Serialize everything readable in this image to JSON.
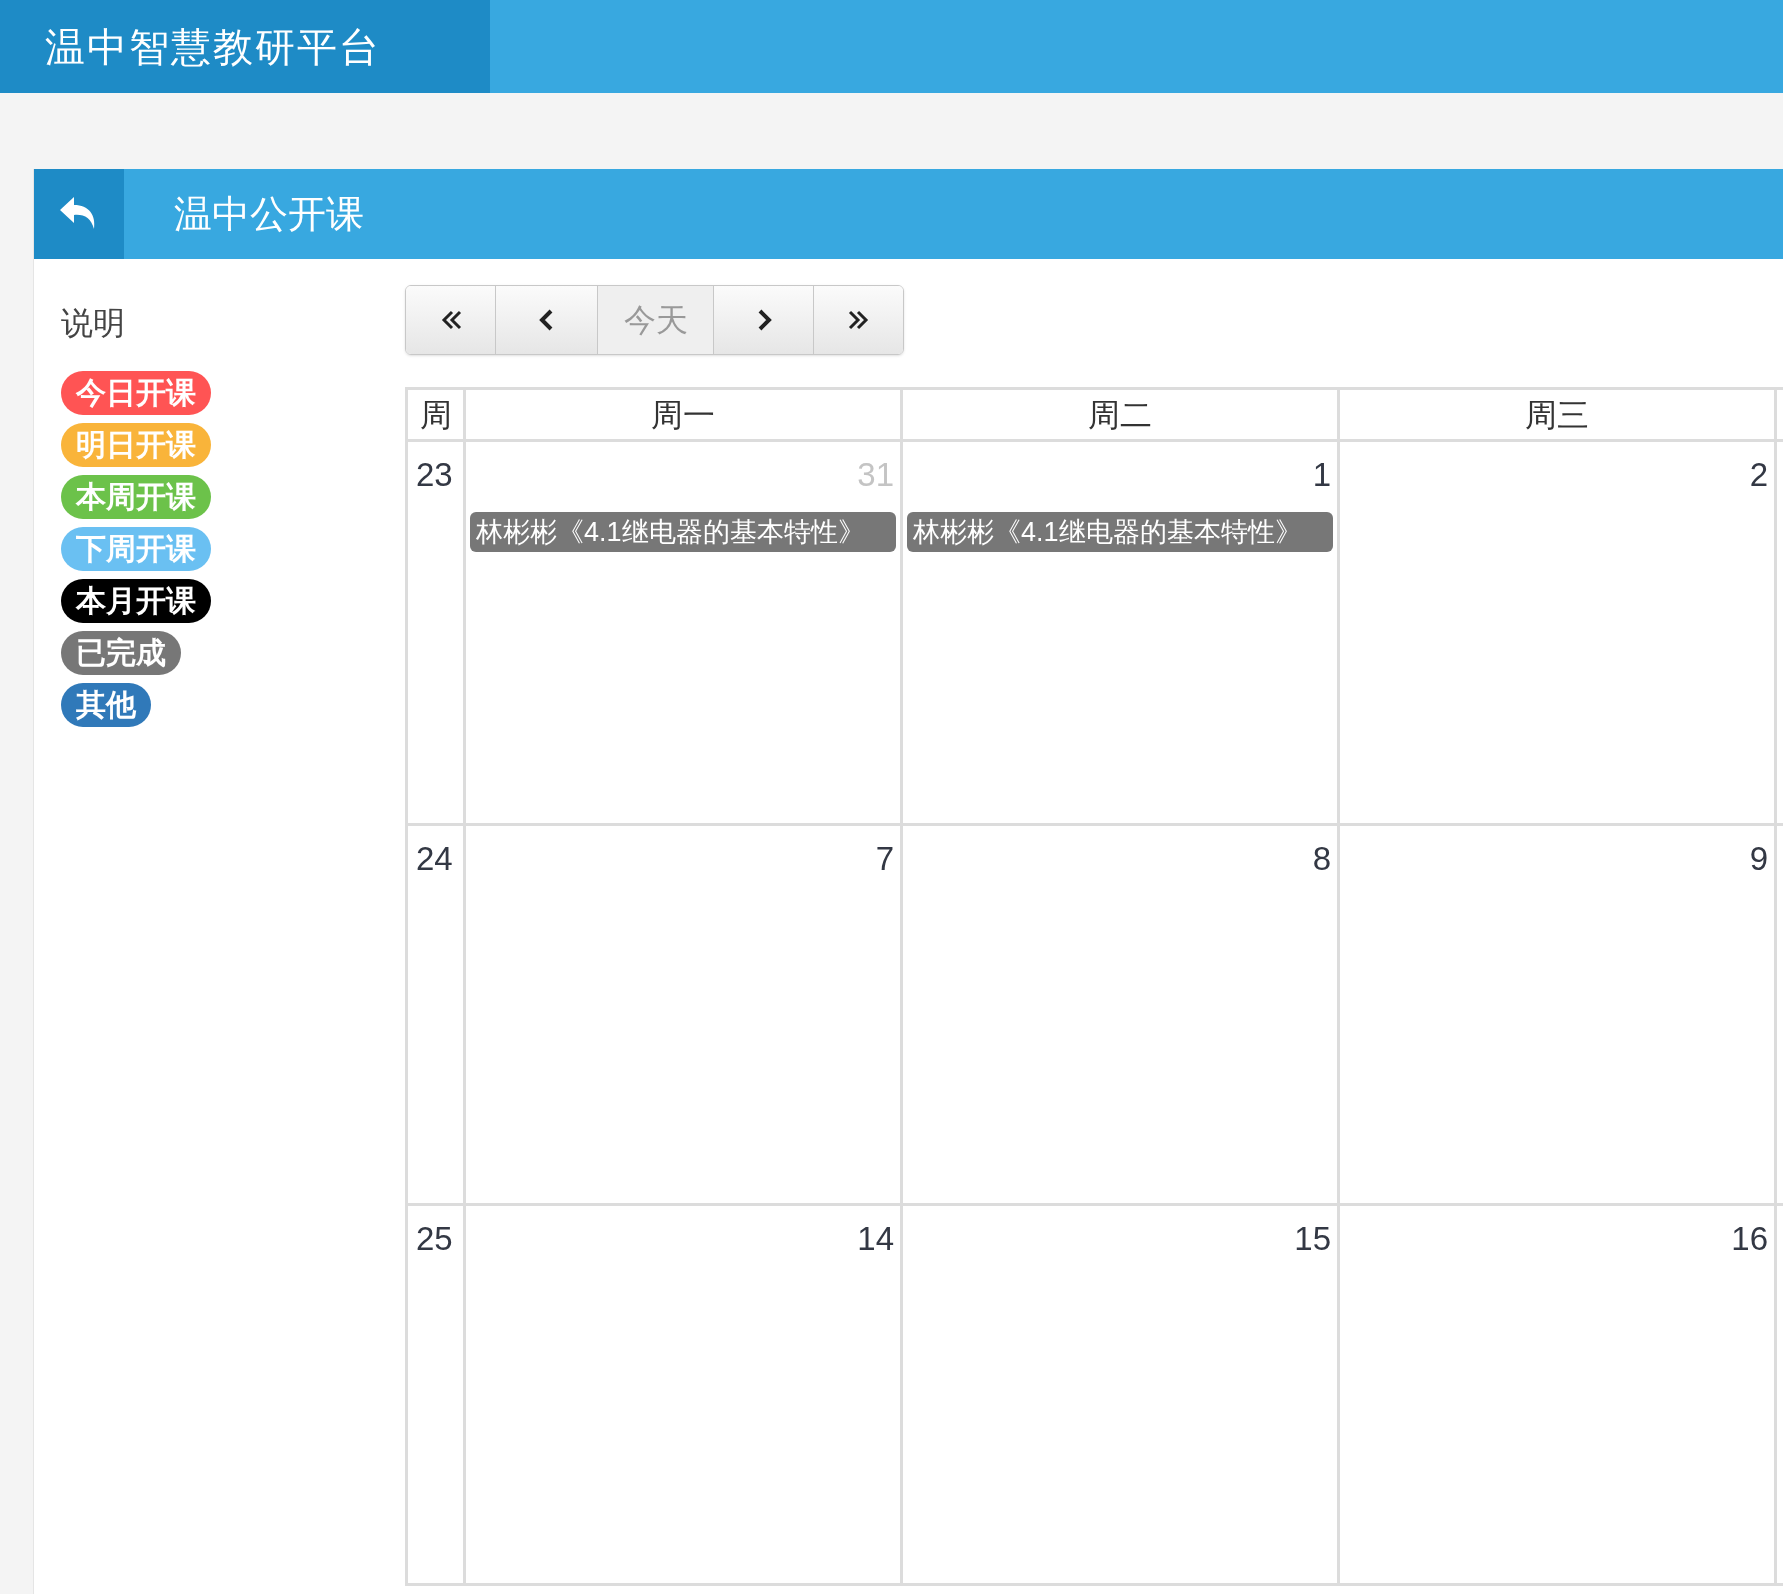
{
  "app_title": "温中智慧教研平台",
  "panel": {
    "title": "温中公开课"
  },
  "legend": {
    "title": "说明",
    "items": [
      {
        "label": "今日开课",
        "color": "#ff5454"
      },
      {
        "label": "明日开课",
        "color": "#f9b43a"
      },
      {
        "label": "本周开课",
        "color": "#6cc24a"
      },
      {
        "label": "下周开课",
        "color": "#6ac0f2"
      },
      {
        "label": "本月开课",
        "color": "#000000"
      },
      {
        "label": "已完成",
        "color": "#777777"
      },
      {
        "label": "其他",
        "color": "#3079b9"
      }
    ]
  },
  "toolbar": [
    {
      "kind": "first",
      "disabled": false
    },
    {
      "kind": "prev",
      "disabled": false
    },
    {
      "kind": "today",
      "label": "今天",
      "disabled": true
    },
    {
      "kind": "next",
      "disabled": false
    },
    {
      "kind": "last",
      "disabled": false
    }
  ],
  "calendar": {
    "columns": [
      "周",
      "周一",
      "周二",
      "周三"
    ],
    "weeks": [
      {
        "week": "23",
        "days": [
          {
            "date": "31",
            "other_month": true,
            "events": [
              {
                "title": "林彬彬《4.1继电器的基本特性》",
                "color": "#777777"
              }
            ]
          },
          {
            "date": "1",
            "other_month": false,
            "events": [
              {
                "title": "林彬彬《4.1继电器的基本特性》",
                "color": "#777777"
              }
            ]
          },
          {
            "date": "2",
            "other_month": false
          }
        ]
      },
      {
        "week": "24",
        "days": [
          {
            "date": "7",
            "other_month": false
          },
          {
            "date": "8",
            "other_month": false
          },
          {
            "date": "9",
            "other_month": false
          }
        ]
      },
      {
        "week": "25",
        "days": [
          {
            "date": "14",
            "other_month": false
          },
          {
            "date": "15",
            "other_month": false
          },
          {
            "date": "16",
            "other_month": false
          }
        ]
      }
    ]
  }
}
